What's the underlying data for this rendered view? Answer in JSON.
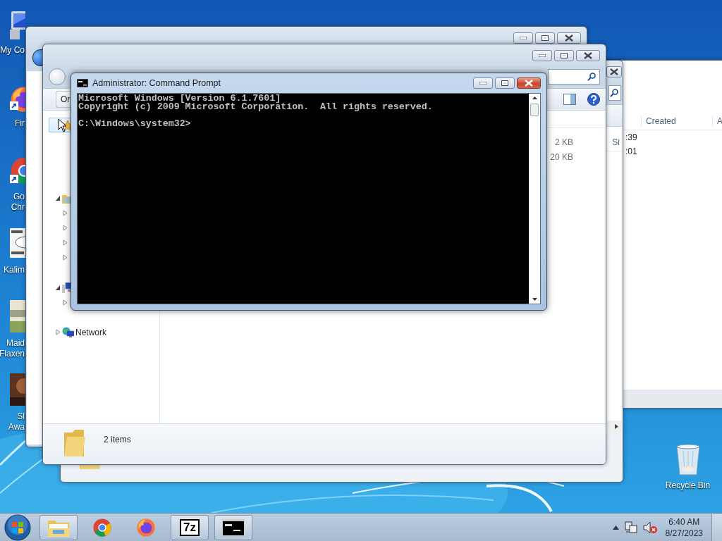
{
  "desktop_icons": [
    {
      "kind": "computer",
      "lines": [
        "My Co"
      ]
    },
    {
      "kind": "firefox",
      "lines": [
        "Fir"
      ]
    },
    {
      "kind": "chrome",
      "lines": [
        "Go",
        "Chr"
      ]
    },
    {
      "kind": "note",
      "lines": [
        "Kalim"
      ]
    },
    {
      "kind": "book",
      "lines": [
        "Maid",
        "Flaxen"
      ]
    },
    {
      "lines": [
        "Sl",
        "Awa"
      ]
    }
  ],
  "recycle_bin": {
    "label": "Recycle Bin"
  },
  "back_window": {
    "columns": [
      "Created",
      "A"
    ],
    "cells": [
      ":39",
      ":01"
    ]
  },
  "middle_window": {
    "column": "Si"
  },
  "explorer": {
    "toolbar_button": "Or",
    "navigation": [
      {
        "kind": "favorites",
        "selected": true
      },
      {
        "kind": "libraries",
        "selected": false,
        "expanded": true,
        "children": [
          {
            "expanded": false
          },
          {
            "expanded": false
          },
          {
            "expanded": false
          },
          {
            "expanded": false
          }
        ]
      },
      {
        "kind": "computer",
        "selected": false,
        "expanded": true,
        "children": [
          {
            "expanded": false
          }
        ]
      },
      {
        "kind": "network",
        "selected": false,
        "expanded": false,
        "label": "Network"
      }
    ],
    "sizes": [
      "2 KB",
      "20 KB"
    ],
    "status": "2 items"
  },
  "console": {
    "title": "Administrator:  Command Prompt",
    "lines": [
      "Microsoft Windows [Version 6.1.7601]",
      "Copyright (c) 2009 Microsoft Corporation.  All rights reserved."
    ],
    "prompt": "C:\\Windows\\system32>"
  },
  "taskbar": {
    "items": [
      {
        "kind": "explorer",
        "running": true
      },
      {
        "kind": "chrome",
        "running": false
      },
      {
        "kind": "firefox",
        "running": false
      },
      {
        "kind": "archiver",
        "running": true,
        "label": "7z"
      },
      {
        "kind": "console",
        "running": true
      }
    ],
    "tray": {
      "muted": true
    },
    "clock": {
      "time": "6:40 AM",
      "date": "8/27/2023"
    }
  }
}
